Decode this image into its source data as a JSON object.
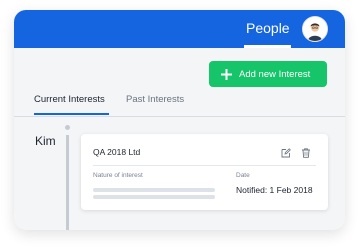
{
  "header": {
    "title": "People",
    "avatar_icon": "user-avatar-icon"
  },
  "actions": {
    "add_label": "Add new Interest",
    "add_icon": "plus-icon",
    "accent_color": "#16c46a"
  },
  "tabs": [
    {
      "label": "Current Interests",
      "active": true
    },
    {
      "label": "Past Interests",
      "active": false
    }
  ],
  "person": {
    "name": "Kim"
  },
  "card": {
    "title": "QA 2018 Ltd",
    "edit_icon": "edit-icon",
    "delete_icon": "trash-icon",
    "nature_label": "Nature of interest",
    "date_label": "Date",
    "date_value": "Notified: 1 Feb 2018"
  },
  "colors": {
    "brand": "#1565e0",
    "success": "#16c46a"
  }
}
